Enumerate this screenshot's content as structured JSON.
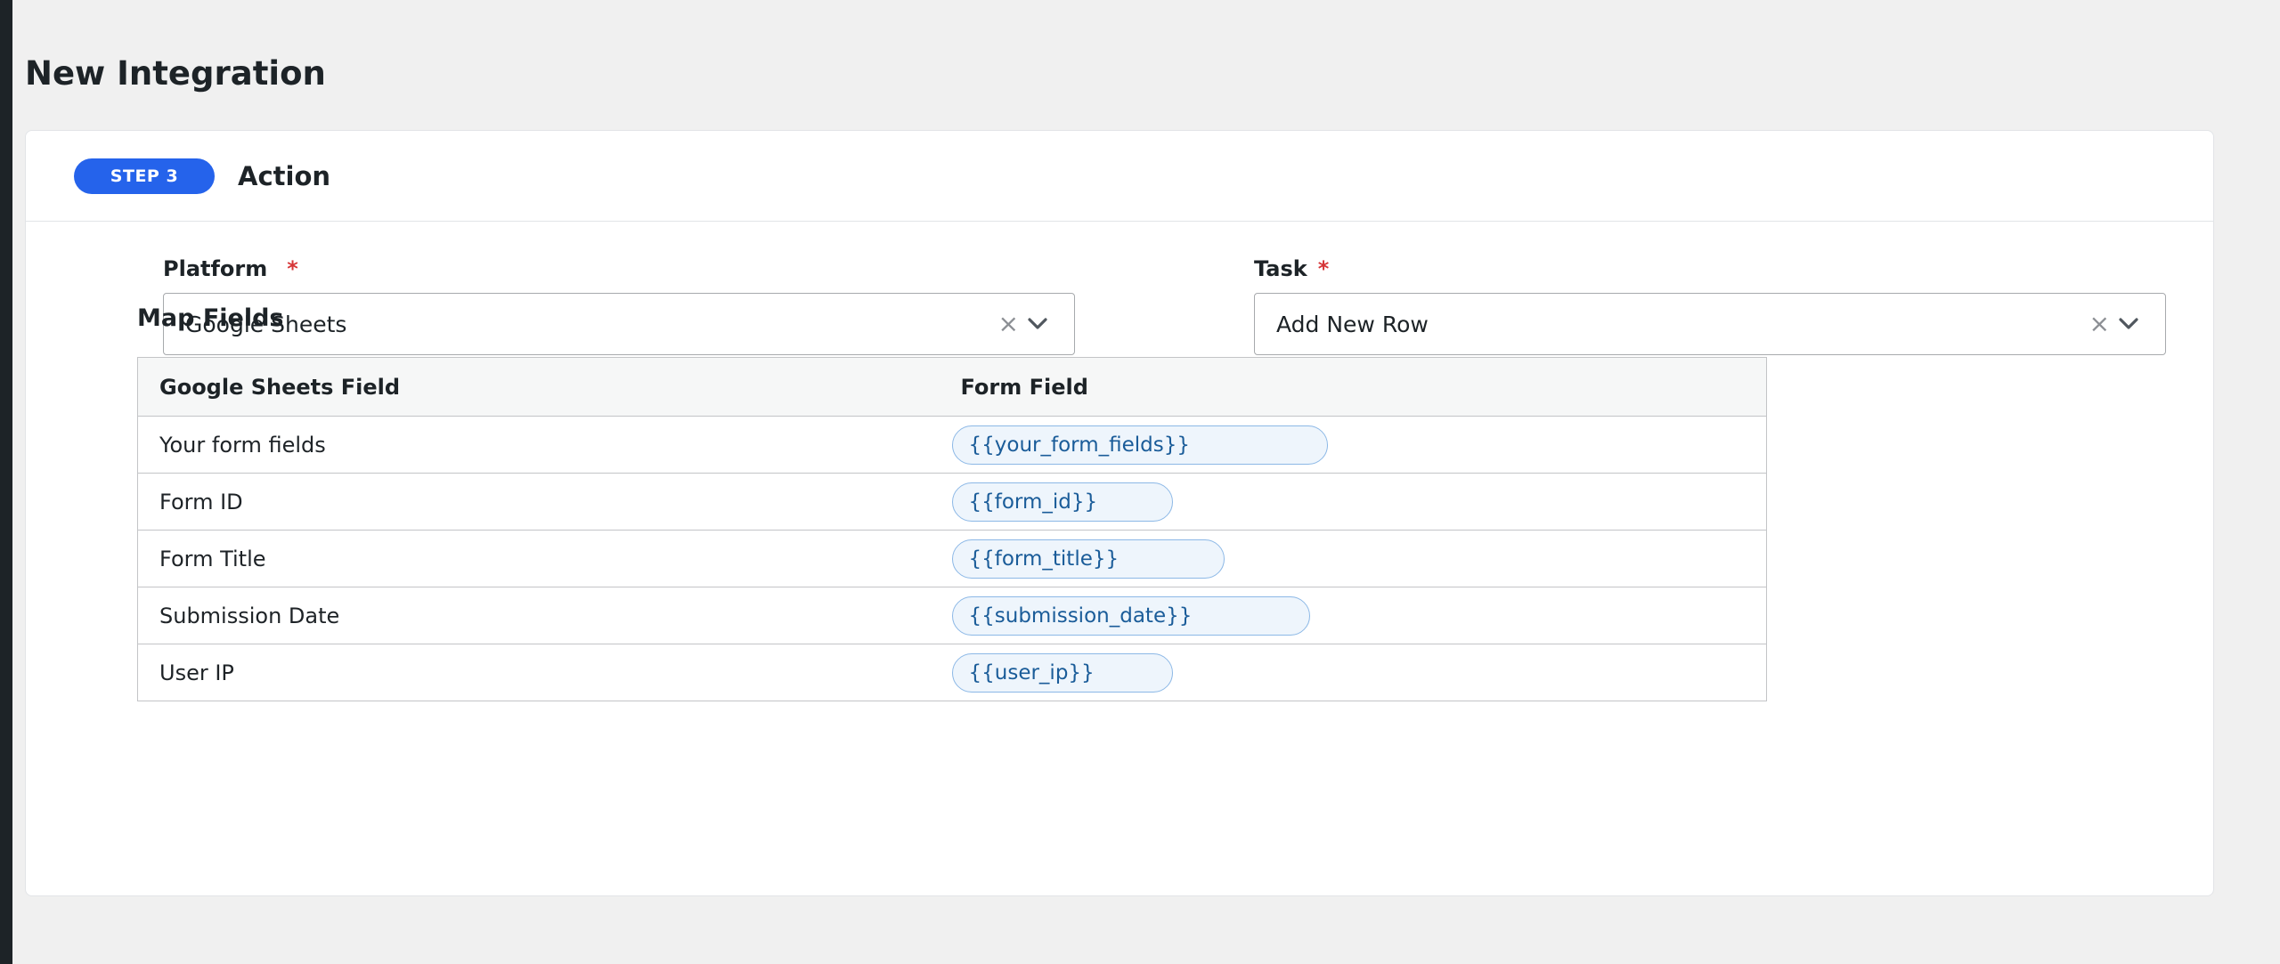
{
  "page": {
    "title": "New Integration"
  },
  "step": {
    "badge": "STEP 3",
    "title": "Action"
  },
  "platform": {
    "label": "Platform",
    "required_mark": "*",
    "value": "Google Sheets"
  },
  "task": {
    "label": "Task",
    "required_mark": "*",
    "value": "Add New Row"
  },
  "map_fields": {
    "title": "Map Fields",
    "columns": [
      "Google Sheets Field",
      "Form Field"
    ],
    "rows": [
      {
        "field": "Your form fields",
        "tag": "{{your_form_fields}}",
        "tag_width": 422
      },
      {
        "field": "Form ID",
        "tag": "{{form_id}}",
        "tag_width": 248
      },
      {
        "field": "Form Title",
        "tag": "{{form_title}}",
        "tag_width": 306
      },
      {
        "field": "Submission Date",
        "tag": "{{submission_date}}",
        "tag_width": 402
      },
      {
        "field": "User IP",
        "tag": "{{user_ip}}",
        "tag_width": 248
      }
    ]
  },
  "icons": {
    "clear": "close-icon",
    "dropdown": "chevron-down-icon"
  },
  "colors": {
    "accent": "#2563eb",
    "required": "#d63638",
    "tag_border": "#8cb8e6",
    "tag_background": "#eef5fc",
    "tag_text": "#1a5c99"
  }
}
